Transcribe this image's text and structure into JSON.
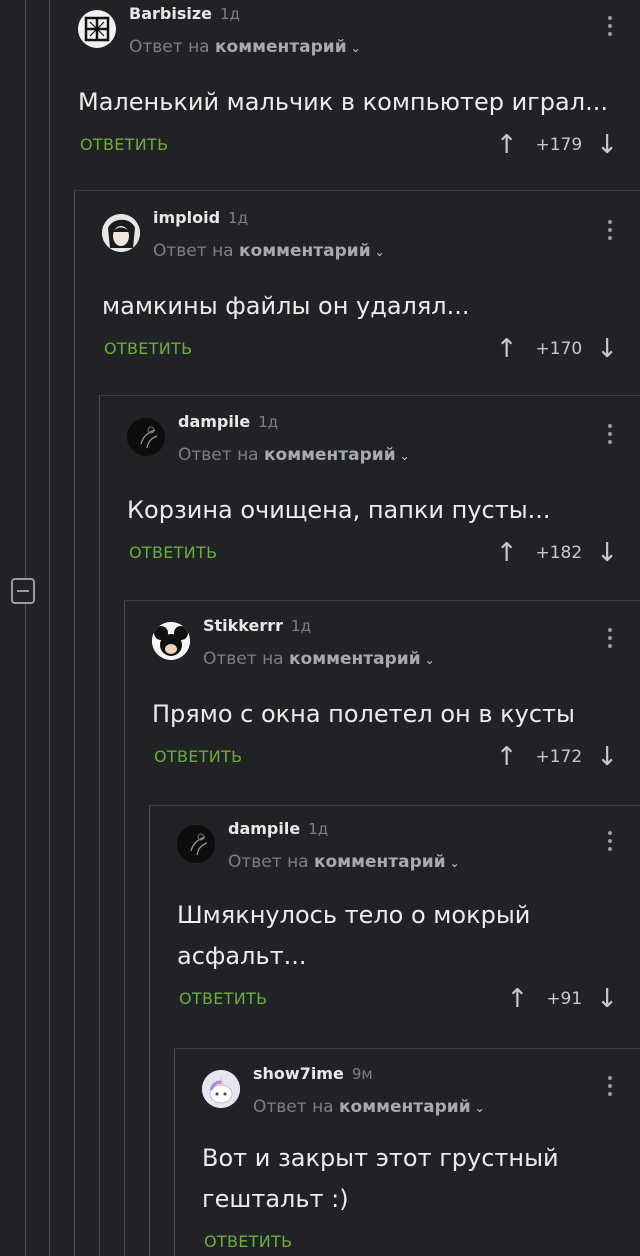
{
  "ui": {
    "reply_to_prefix": "Ответ на",
    "reply_to_target": "комментарий",
    "reply_button": "ОТВЕТИТЬ"
  },
  "comments": [
    {
      "author": "Barbisize",
      "time": "1д",
      "text": "Маленький мальчик в компьютер играл...",
      "score": "+179",
      "avatar": "rammstein-logo-avatar"
    },
    {
      "author": "imploid",
      "time": "1д",
      "text": "мамкины файлы он удалял...",
      "score": "+170",
      "avatar": "anime-avatar"
    },
    {
      "author": "dampile",
      "time": "1д",
      "text": "Корзина очищена, папки пусты...",
      "score": "+182",
      "avatar": "dark-sketch-avatar"
    },
    {
      "author": "Stikkerrr",
      "time": "1д",
      "text": "Прямо с окна полетел он в кусты",
      "score": "+172",
      "avatar": "mickey-avatar"
    },
    {
      "author": "dampile",
      "time": "1д",
      "text_lines": [
        "Шмякнулось тело о мокрый",
        "асфальт..."
      ],
      "score": "+91",
      "avatar": "dark-sketch-avatar"
    },
    {
      "author": "show7ime",
      "time": "9м",
      "text_lines": [
        "Вот и закрыт этот грустный",
        "гештальт :)"
      ],
      "avatar": "unicorn-avatar"
    }
  ],
  "colors": {
    "background": "#212226",
    "accent": "#6cae3a",
    "thread_line": "#4a4c51"
  }
}
